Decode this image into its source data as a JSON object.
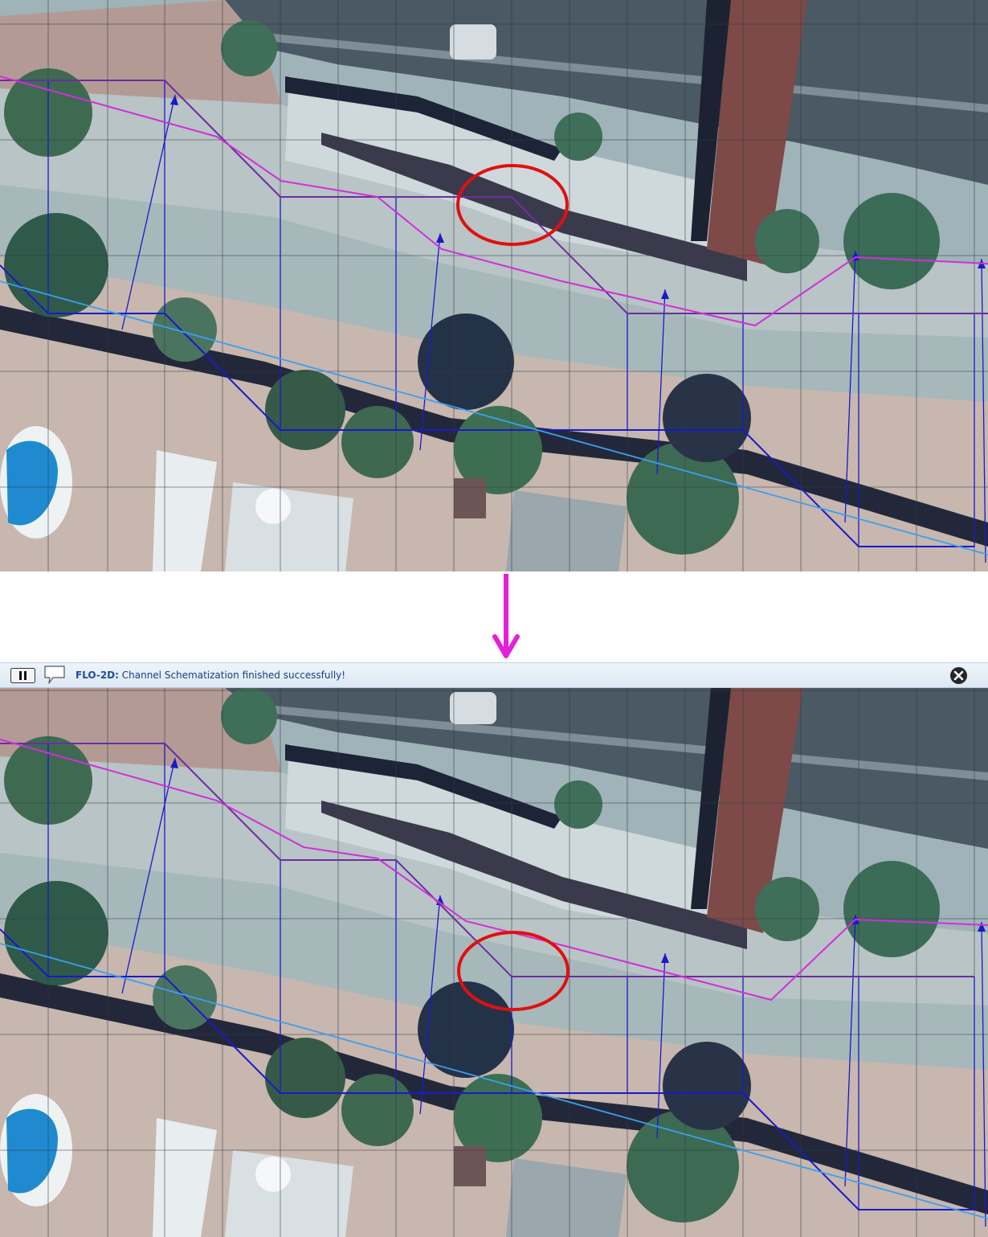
{
  "message_bar": {
    "source": "FLO-2D:",
    "text": " Channel Schematization finished successfully!"
  },
  "icons": {
    "pause": "pause-icon",
    "comment": "speech-bubble-icon",
    "close": "close-circle-icon",
    "arrow": "arrow-down-icon",
    "highlight": "red-ellipse-marker"
  },
  "colors": {
    "accent_arrow": "#e61fd8",
    "highlight_circle": "#e01010",
    "channel_bank_left": "#6a2ea0",
    "channel_bank_right": "#d030d8",
    "channel_center": "#3aa0f0",
    "cross_sections": "#1a1ac8",
    "grid": "#333a4a"
  },
  "panels": [
    {
      "name": "before"
    },
    {
      "name": "after"
    }
  ]
}
